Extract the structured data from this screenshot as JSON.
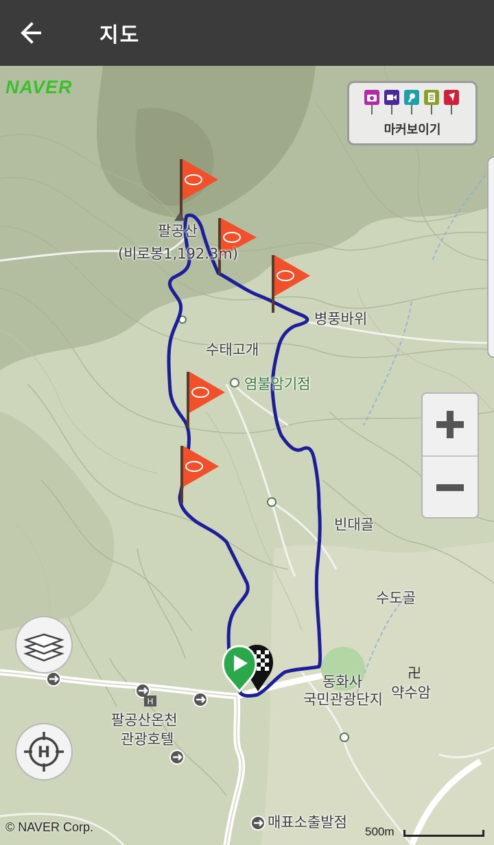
{
  "appbar": {
    "title": "지도",
    "back_icon": "arrow-left-icon"
  },
  "map": {
    "brand": "NAVER",
    "copyright": "© NAVER Corp.",
    "scale_label": "500m",
    "colors": {
      "route": "#1e1e9a",
      "flag": "#f0502a",
      "start": "#2aa84a",
      "brand": "#39c12b"
    }
  },
  "marker_panel": {
    "label": "마커보이기",
    "pins": [
      {
        "icon": "camera-icon",
        "color": "#b32aa8"
      },
      {
        "icon": "video-icon",
        "color": "#4a2a9a"
      },
      {
        "icon": "microphone-icon",
        "color": "#1ea0a8"
      },
      {
        "icon": "memo-icon",
        "color": "#8aa02a"
      },
      {
        "icon": "flag-icon",
        "color": "#d0203a"
      }
    ]
  },
  "zoom": {
    "in_icon": "plus-icon",
    "out_icon": "minus-icon"
  },
  "places": {
    "peak_name": "팔공산",
    "peak_sub": "(비로봉1,192.3m)",
    "byeongpung": "병풍바위",
    "sutae": "수태고개",
    "yeombul": "염불암기점",
    "bindae": "빈대골",
    "sudo": "수도골",
    "donghwa_1": "동화사",
    "donghwa_2": "국민관광단지",
    "yaksu": "약수암",
    "hotel_1": "팔공산온천",
    "hotel_2": "관광호텔",
    "maepyo": "매표소출발점"
  }
}
